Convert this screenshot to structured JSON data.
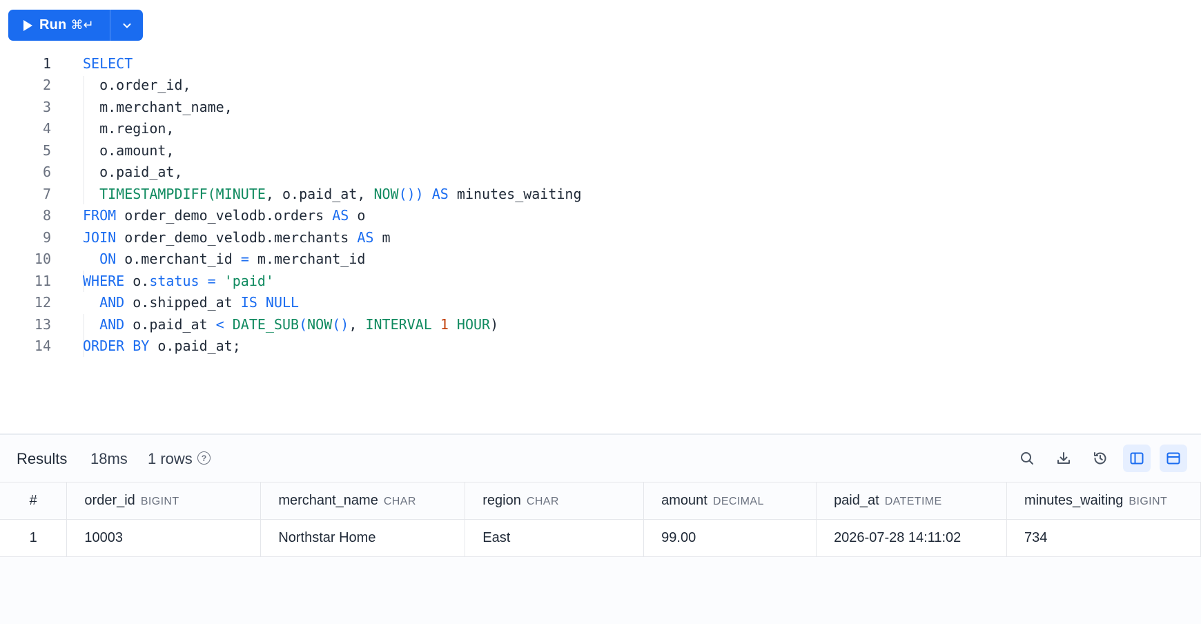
{
  "toolbar": {
    "run_label": "Run",
    "run_shortcut": "⌘↵"
  },
  "editor": {
    "active_line": 1,
    "line_numbers": [
      "1",
      "2",
      "3",
      "4",
      "5",
      "6",
      "7",
      "8",
      "9",
      "10",
      "11",
      "12",
      "13",
      "14"
    ],
    "lines": [
      "SELECT",
      "  o.order_id,",
      "  m.merchant_name,",
      "  m.region,",
      "  o.amount,",
      "  o.paid_at,",
      "  TIMESTAMPDIFF(MINUTE, o.paid_at, NOW()) AS minutes_waiting",
      "FROM order_demo_velodb.orders AS o",
      "JOIN order_demo_velodb.merchants AS m",
      "  ON o.merchant_id = m.merchant_id",
      "WHERE o.status = 'paid'",
      "  AND o.shipped_at IS NULL",
      "  AND o.paid_at < DATE_SUB(NOW(), INTERVAL 1 HOUR)",
      "ORDER BY o.paid_at;"
    ]
  },
  "results": {
    "title": "Results",
    "elapsed": "18ms",
    "row_count": "1 rows",
    "columns": [
      {
        "name": "#",
        "type": ""
      },
      {
        "name": "order_id",
        "type": "BIGINT"
      },
      {
        "name": "merchant_name",
        "type": "CHAR"
      },
      {
        "name": "region",
        "type": "CHAR"
      },
      {
        "name": "amount",
        "type": "DECIMAL"
      },
      {
        "name": "paid_at",
        "type": "DATETIME"
      },
      {
        "name": "minutes_waiting",
        "type": "BIGINT"
      }
    ],
    "rows": [
      [
        "1",
        "10003",
        "Northstar Home",
        "East",
        "99.00",
        "2026-07-28 14:11:02",
        "734"
      ]
    ]
  },
  "icons": [
    "search-icon",
    "download-icon",
    "history-icon",
    "split-vertical-icon",
    "split-horizontal-icon"
  ],
  "colors": {
    "accent": "#1a6cf0",
    "keyword": "#1a6cf0",
    "function": "#0f8a5f",
    "number": "#c2410c"
  }
}
